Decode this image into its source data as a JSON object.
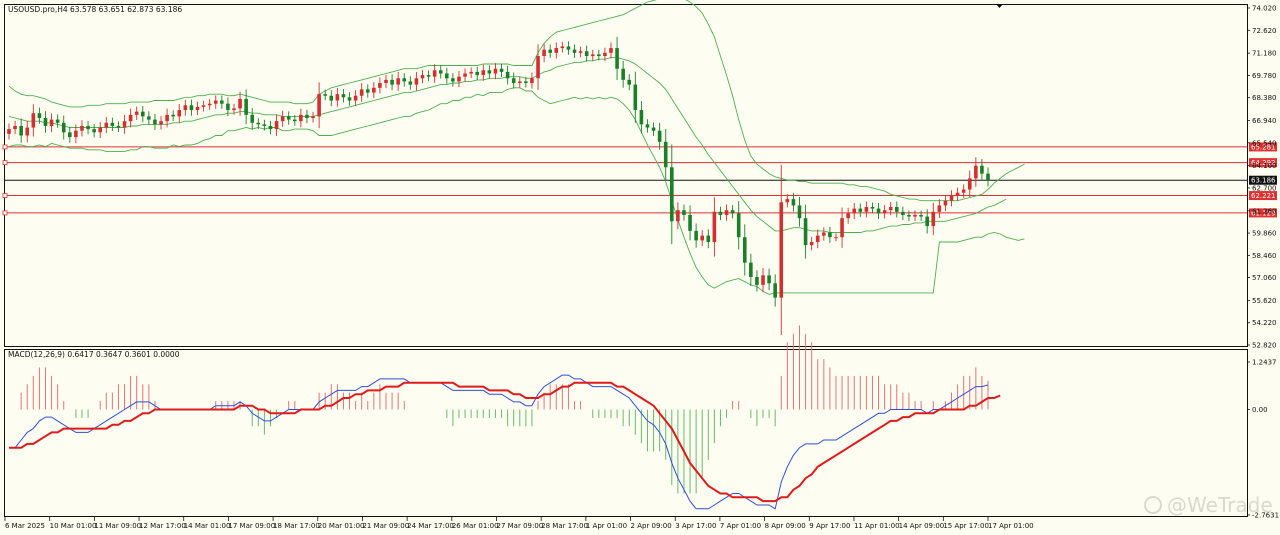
{
  "chart_data": {
    "type": "candlestick",
    "symbol_header": "USOUSD.pro,H4  63.578 63.651 62.873 63.186",
    "price_axis_labels": [
      "74.020",
      "72.620",
      "71.180",
      "69.780",
      "68.380",
      "66.940",
      "65.540",
      "64.100",
      "62.700",
      "61.260",
      "59.860",
      "58.460",
      "57.060",
      "55.620",
      "54.220",
      "52.820"
    ],
    "price_range": [
      52.82,
      74.02
    ],
    "current_price": "63.186",
    "horizontal_levels": [
      {
        "label": "65.281",
        "value": 65.281,
        "color": "#e03030"
      },
      {
        "label": "64.292",
        "value": 64.292,
        "color": "#e03030"
      },
      {
        "label": "62.221",
        "value": 62.221,
        "color": "#e03030"
      },
      {
        "label": "61.129",
        "value": 61.129,
        "color": "#e03030"
      }
    ],
    "time_labels": [
      "6 Mar 2025",
      "10 Mar 01:00",
      "11 Mar 09:00",
      "12 Mar 17:00",
      "14 Mar 01:00",
      "17 Mar 09:00",
      "18 Mar 17:00",
      "20 Mar 01:00",
      "21 Mar 09:00",
      "24 Mar 17:00",
      "26 Mar 01:00",
      "27 Mar 09:00",
      "28 Mar 17:00",
      "1 Apr 01:00",
      "2 Apr 09:00",
      "3 Apr 17:00",
      "7 Apr 01:00",
      "8 Apr 09:00",
      "9 Apr 17:00",
      "11 Apr 01:00",
      "14 Apr 09:00",
      "15 Apr 17:00",
      "17 Apr 01:00"
    ],
    "closes": [
      66.4,
      66.6,
      66.0,
      66.5,
      67.4,
      67.1,
      66.6,
      67.0,
      66.8,
      66.2,
      65.9,
      66.3,
      66.6,
      66.4,
      66.2,
      66.5,
      66.8,
      66.6,
      66.5,
      66.9,
      67.3,
      67.5,
      67.2,
      67.0,
      66.7,
      66.9,
      67.3,
      67.2,
      67.6,
      67.9,
      67.6,
      67.8,
      67.9,
      68.0,
      68.2,
      68.0,
      67.6,
      67.7,
      68.3,
      67.3,
      66.8,
      66.7,
      66.6,
      66.4,
      66.9,
      67.2,
      67.0,
      66.9,
      67.3,
      67.1,
      67.2,
      68.6,
      68.5,
      68.2,
      68.6,
      68.4,
      68.2,
      68.5,
      68.9,
      68.7,
      69.0,
      69.3,
      69.5,
      69.2,
      69.6,
      69.4,
      69.2,
      69.6,
      69.8,
      69.7,
      70.1,
      69.9,
      69.6,
      69.4,
      69.7,
      69.9,
      70.0,
      69.8,
      70.1,
      69.9,
      70.2,
      70.0,
      69.6,
      69.3,
      69.4,
      69.3,
      69.6,
      71.0,
      71.4,
      71.2,
      71.5,
      71.6,
      71.4,
      71.2,
      71.3,
      71.0,
      71.1,
      71.0,
      71.2,
      71.5,
      70.2,
      69.5,
      69.2,
      67.6,
      66.7,
      66.5,
      66.3,
      65.6,
      64.0,
      60.6,
      61.3,
      61.0,
      60.0,
      59.4,
      59.7,
      59.3,
      61.2,
      61.0,
      61.3,
      61.1,
      59.6,
      58.0,
      57.1,
      56.6,
      57.2,
      56.7,
      55.8,
      61.8,
      62.0,
      61.6,
      60.8,
      59.1,
      59.3,
      59.7,
      59.9,
      59.6,
      59.6,
      60.8,
      61.1,
      61.4,
      61.2,
      61.5,
      61.4,
      61.1,
      61.3,
      61.5,
      61.2,
      61.0,
      60.9,
      61.0,
      60.9,
      60.3,
      61.2,
      61.6,
      61.9,
      62.2,
      62.4,
      62.6,
      63.3,
      64.1,
      63.6,
      63.186
    ],
    "bollinger_upper": [
      69.1,
      68.8,
      68.6,
      68.5,
      68.5,
      68.4,
      68.3,
      68.1,
      68.0,
      67.9,
      67.8,
      67.8,
      67.8,
      67.9,
      67.9,
      67.9,
      68.0,
      68.0,
      68.0,
      68.0,
      68.1,
      68.1,
      68.1,
      68.1,
      68.2,
      68.2,
      68.2,
      68.2,
      68.3,
      68.4,
      68.4,
      68.5,
      68.5,
      68.6,
      68.6,
      68.6,
      68.5,
      68.5,
      68.6,
      68.5,
      68.4,
      68.3,
      68.2,
      68.1,
      68.1,
      68.1,
      68.1,
      68.0,
      68.0,
      68.0,
      68.1,
      68.6,
      68.8,
      69.0,
      69.1,
      69.2,
      69.3,
      69.4,
      69.5,
      69.6,
      69.7,
      69.8,
      69.9,
      70.0,
      70.1,
      70.2,
      70.2,
      70.2,
      70.3,
      70.4,
      70.4,
      70.4,
      70.4,
      70.4,
      70.4,
      70.4,
      70.4,
      70.4,
      70.5,
      70.5,
      70.5,
      70.5,
      70.5,
      70.4,
      70.4,
      70.4,
      70.4,
      71.2,
      71.8,
      72.2,
      72.5,
      72.6,
      72.7,
      72.8,
      72.9,
      73.0,
      73.1,
      73.2,
      73.3,
      73.4,
      73.5,
      73.6,
      73.8,
      74.0,
      74.2,
      74.4,
      74.5,
      74.6,
      74.7,
      74.7,
      74.7,
      74.6,
      74.4,
      74.1,
      73.7,
      73.0,
      72.2,
      71.0,
      69.8,
      68.5,
      67.0,
      65.7,
      64.7,
      64.2,
      63.9,
      63.6,
      63.4,
      63.3,
      63.2,
      63.2,
      63.1,
      63.1,
      63.0,
      63.0,
      63.0,
      63.0,
      63.0,
      63.0,
      62.9,
      62.9,
      62.8,
      62.8,
      62.7,
      62.6,
      62.5,
      62.3,
      62.2,
      62.1,
      62.0,
      62.0,
      61.9,
      61.9,
      61.9,
      61.9,
      61.9,
      61.9,
      61.9,
      62.0,
      62.1,
      62.2,
      62.3,
      62.6,
      63.0,
      63.3,
      63.6,
      63.8,
      64.0,
      64.2
    ],
    "bollinger_middle": [
      67.2,
      67.1,
      67.0,
      66.9,
      66.9,
      66.9,
      66.8,
      66.8,
      66.7,
      66.6,
      66.5,
      66.5,
      66.5,
      66.5,
      66.5,
      66.5,
      66.5,
      66.5,
      66.5,
      66.5,
      66.6,
      66.6,
      66.7,
      66.7,
      66.7,
      66.7,
      66.7,
      66.8,
      66.8,
      66.9,
      66.9,
      67.0,
      67.1,
      67.2,
      67.3,
      67.3,
      67.4,
      67.4,
      67.5,
      67.5,
      67.4,
      67.4,
      67.3,
      67.3,
      67.3,
      67.2,
      67.2,
      67.2,
      67.2,
      67.2,
      67.2,
      67.3,
      67.4,
      67.5,
      67.6,
      67.7,
      67.8,
      67.9,
      68.0,
      68.1,
      68.2,
      68.3,
      68.4,
      68.5,
      68.6,
      68.7,
      68.7,
      68.8,
      68.9,
      69.0,
      69.1,
      69.2,
      69.2,
      69.3,
      69.3,
      69.4,
      69.4,
      69.5,
      69.5,
      69.6,
      69.6,
      69.6,
      69.7,
      69.7,
      69.7,
      69.6,
      69.6,
      69.8,
      70.0,
      70.1,
      70.3,
      70.4,
      70.5,
      70.6,
      70.6,
      70.7,
      70.7,
      70.8,
      70.8,
      70.9,
      70.9,
      70.8,
      70.7,
      70.5,
      70.2,
      69.9,
      69.6,
      69.3,
      68.9,
      68.3,
      67.7,
      67.1,
      66.5,
      65.9,
      65.4,
      64.8,
      64.3,
      63.8,
      63.3,
      62.8,
      62.3,
      61.8,
      61.3,
      60.9,
      60.6,
      60.3,
      60.0,
      60.0,
      60.1,
      60.2,
      60.2,
      60.1,
      60.0,
      60.0,
      60.0,
      59.9,
      59.9,
      59.9,
      59.9,
      59.9,
      59.9,
      60.0,
      60.0,
      60.1,
      60.2,
      60.3,
      60.3,
      60.4,
      60.4,
      60.5,
      60.5,
      60.6,
      60.6,
      60.6,
      60.6,
      60.7,
      60.8,
      60.9,
      61.0,
      61.1,
      61.3,
      61.5,
      61.6,
      61.8,
      62.0
    ],
    "bollinger_lower": [
      65.3,
      65.4,
      65.4,
      65.3,
      65.3,
      65.4,
      65.3,
      65.5,
      65.4,
      65.3,
      65.2,
      65.2,
      65.2,
      65.1,
      65.1,
      65.1,
      65.0,
      65.0,
      65.0,
      65.0,
      65.1,
      65.1,
      65.3,
      65.3,
      65.2,
      65.2,
      65.2,
      65.4,
      65.3,
      65.4,
      65.4,
      65.5,
      65.7,
      65.8,
      66.0,
      66.0,
      66.3,
      66.3,
      66.4,
      66.5,
      66.4,
      66.5,
      66.4,
      66.5,
      66.5,
      66.3,
      66.3,
      66.4,
      66.4,
      66.4,
      66.3,
      66.0,
      66.0,
      66.0,
      66.1,
      66.2,
      66.3,
      66.4,
      66.5,
      66.6,
      66.7,
      66.8,
      66.9,
      67.0,
      67.1,
      67.2,
      67.2,
      67.4,
      67.5,
      67.6,
      67.8,
      68.0,
      68.0,
      68.2,
      68.2,
      68.4,
      68.4,
      68.6,
      68.5,
      68.7,
      68.7,
      68.7,
      68.9,
      69.0,
      69.0,
      68.8,
      68.8,
      68.4,
      68.2,
      68.0,
      68.1,
      68.2,
      68.3,
      68.4,
      68.3,
      68.4,
      68.3,
      68.4,
      68.3,
      68.4,
      68.3,
      68.0,
      67.6,
      67.0,
      66.2,
      65.4,
      64.7,
      64.0,
      63.1,
      61.9,
      60.7,
      59.6,
      58.6,
      57.7,
      57.1,
      56.6,
      56.4,
      56.6,
      56.8,
      56.9,
      57.0,
      56.8,
      56.6,
      56.5,
      56.2,
      56.0,
      56.1,
      56.1,
      56.1,
      56.1,
      56.1,
      56.1,
      56.1,
      56.1,
      56.1,
      56.1,
      56.1,
      56.1,
      56.1,
      56.1,
      56.1,
      56.1,
      56.1,
      56.1,
      56.1,
      56.1,
      56.1,
      56.1,
      56.1,
      56.1,
      56.1,
      56.1,
      56.1,
      59.3,
      59.3,
      59.3,
      59.3,
      59.4,
      59.5,
      59.6,
      59.6,
      59.8,
      59.9,
      59.8,
      59.6,
      59.5,
      59.4,
      59.5
    ],
    "macd_header": "MACD(12,26,9) 0.6417 0.3647 0.3601 0.0000",
    "macd_axis_labels": [
      "1.2437",
      "0.00",
      "-2.7631"
    ],
    "macd_range": [
      -2.7631,
      1.2437
    ],
    "macd_line": [
      -1.0,
      -1.0,
      -0.8,
      -0.6,
      -0.5,
      -0.3,
      -0.2,
      -0.2,
      -0.3,
      -0.4,
      -0.5,
      -0.6,
      -0.6,
      -0.6,
      -0.5,
      -0.4,
      -0.3,
      -0.2,
      -0.1,
      0.0,
      0.1,
      0.2,
      0.2,
      0.2,
      0.1,
      0.0,
      0.0,
      0.0,
      0.0,
      0.0,
      0.0,
      0.0,
      0.0,
      0.0,
      0.1,
      0.1,
      0.1,
      0.1,
      0.2,
      0.1,
      -0.1,
      -0.2,
      -0.3,
      -0.3,
      -0.2,
      -0.1,
      0.0,
      0.0,
      0.0,
      0.0,
      0.0,
      0.2,
      0.3,
      0.4,
      0.5,
      0.5,
      0.5,
      0.5,
      0.6,
      0.6,
      0.7,
      0.8,
      0.8,
      0.8,
      0.8,
      0.8,
      0.7,
      0.7,
      0.7,
      0.7,
      0.7,
      0.7,
      0.6,
      0.5,
      0.5,
      0.5,
      0.5,
      0.5,
      0.5,
      0.4,
      0.4,
      0.4,
      0.3,
      0.2,
      0.2,
      0.1,
      0.1,
      0.4,
      0.6,
      0.7,
      0.8,
      0.9,
      0.9,
      0.8,
      0.8,
      0.7,
      0.6,
      0.6,
      0.6,
      0.6,
      0.5,
      0.4,
      0.3,
      0.1,
      -0.1,
      -0.3,
      -0.4,
      -0.6,
      -0.9,
      -1.4,
      -1.8,
      -2.1,
      -2.4,
      -2.6,
      -2.6,
      -2.6,
      -2.5,
      -2.4,
      -2.3,
      -2.2,
      -2.2,
      -2.3,
      -2.4,
      -2.5,
      -2.5,
      -2.5,
      -2.6,
      -1.9,
      -1.5,
      -1.2,
      -1.0,
      -0.9,
      -0.9,
      -0.9,
      -0.8,
      -0.8,
      -0.8,
      -0.7,
      -0.6,
      -0.5,
      -0.4,
      -0.3,
      -0.2,
      -0.1,
      -0.1,
      0.0,
      0.0,
      0.0,
      0.0,
      0.0,
      0.0,
      -0.1,
      0.0,
      0.0,
      0.1,
      0.2,
      0.3,
      0.4,
      0.5,
      0.6,
      0.6,
      0.6417
    ],
    "macd_signal": [
      -1.0,
      -1.0,
      -1.0,
      -0.9,
      -0.9,
      -0.8,
      -0.7,
      -0.6,
      -0.6,
      -0.5,
      -0.5,
      -0.5,
      -0.5,
      -0.5,
      -0.5,
      -0.5,
      -0.5,
      -0.4,
      -0.4,
      -0.3,
      -0.3,
      -0.2,
      -0.1,
      -0.1,
      0.0,
      0.0,
      0.0,
      0.0,
      0.0,
      0.0,
      0.0,
      0.0,
      0.0,
      0.0,
      0.0,
      0.0,
      0.0,
      0.0,
      0.1,
      0.1,
      0.1,
      0.0,
      0.0,
      -0.1,
      -0.1,
      -0.1,
      -0.1,
      -0.1,
      0.0,
      0.0,
      0.0,
      0.0,
      0.1,
      0.1,
      0.2,
      0.3,
      0.3,
      0.4,
      0.4,
      0.5,
      0.5,
      0.5,
      0.6,
      0.6,
      0.6,
      0.7,
      0.7,
      0.7,
      0.7,
      0.7,
      0.7,
      0.7,
      0.7,
      0.7,
      0.6,
      0.6,
      0.6,
      0.6,
      0.6,
      0.5,
      0.5,
      0.5,
      0.5,
      0.4,
      0.4,
      0.3,
      0.3,
      0.3,
      0.4,
      0.4,
      0.5,
      0.6,
      0.6,
      0.7,
      0.7,
      0.7,
      0.7,
      0.7,
      0.7,
      0.7,
      0.6,
      0.6,
      0.5,
      0.4,
      0.3,
      0.2,
      0.1,
      -0.1,
      -0.3,
      -0.5,
      -0.8,
      -1.1,
      -1.4,
      -1.6,
      -1.8,
      -2.0,
      -2.1,
      -2.2,
      -2.2,
      -2.3,
      -2.3,
      -2.3,
      -2.3,
      -2.3,
      -2.4,
      -2.4,
      -2.4,
      -2.3,
      -2.3,
      -2.1,
      -2.0,
      -1.8,
      -1.7,
      -1.5,
      -1.4,
      -1.3,
      -1.2,
      -1.1,
      -1.0,
      -0.9,
      -0.8,
      -0.7,
      -0.6,
      -0.5,
      -0.4,
      -0.3,
      -0.3,
      -0.2,
      -0.2,
      -0.1,
      -0.1,
      -0.1,
      -0.1,
      0.0,
      0.0,
      0.0,
      0.0,
      0.0,
      0.1,
      0.1,
      0.2,
      0.3,
      0.3,
      0.3647
    ]
  },
  "watermark": "@WeTrade"
}
